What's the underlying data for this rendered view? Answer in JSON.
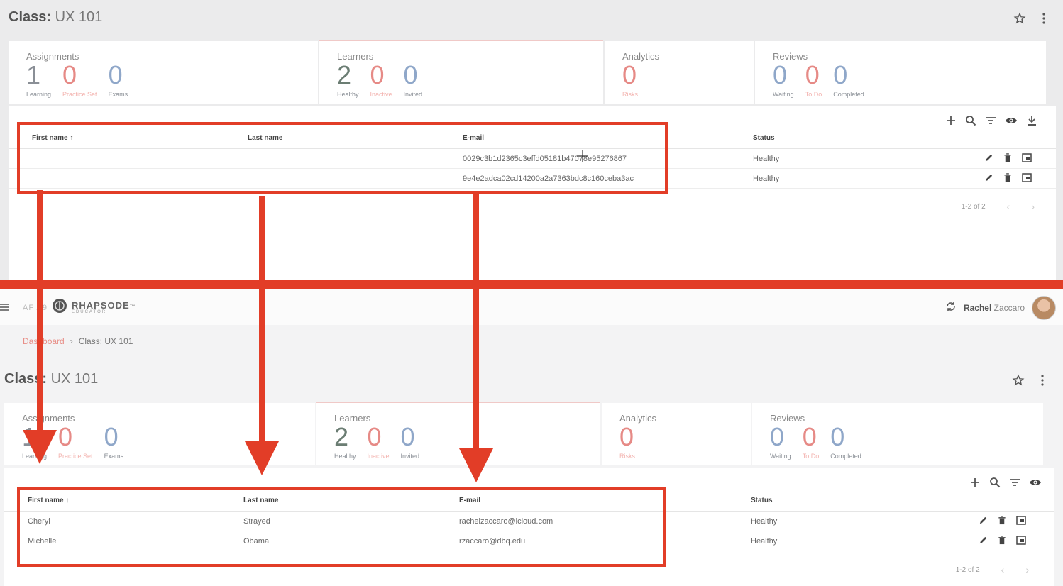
{
  "top": {
    "class_label": "Class:",
    "class_name": "UX 101",
    "cards": {
      "assignments": {
        "title": "Assignments",
        "stats": [
          {
            "value": "1",
            "label": "Learning"
          },
          {
            "value": "0",
            "label": "Practice Set"
          },
          {
            "value": "0",
            "label": "Exams"
          }
        ]
      },
      "learners": {
        "title": "Learners",
        "stats": [
          {
            "value": "2",
            "label": "Healthy"
          },
          {
            "value": "0",
            "label": "Inactive"
          },
          {
            "value": "0",
            "label": "Invited"
          }
        ]
      },
      "analytics": {
        "title": "Analytics",
        "stats": [
          {
            "value": "0",
            "label": "Risks"
          }
        ]
      },
      "reviews": {
        "title": "Reviews",
        "stats": [
          {
            "value": "0",
            "label": "Waiting"
          },
          {
            "value": "0",
            "label": "To Do"
          },
          {
            "value": "0",
            "label": "Completed"
          }
        ]
      }
    },
    "table": {
      "headers": {
        "first": "First name",
        "last": "Last name",
        "email": "E-mail",
        "status": "Status"
      },
      "rows": [
        {
          "first": "",
          "last": "",
          "email": "0029c3b1d2365c3effd05181b47078e95276867",
          "status": "Healthy"
        },
        {
          "first": "",
          "last": "",
          "email": "9e4e2adca02cd14200a2a7363bdc8c160ceba3ac",
          "status": "Healthy"
        }
      ],
      "pager": "1-2 of 2"
    }
  },
  "nav": {
    "tag": "AF A9",
    "brand": "RHAPSODE",
    "brand_tm": "™",
    "sub": "EDUCATOR",
    "user_first": "Rachel",
    "user_last": "Zaccaro",
    "breadcrumb_link": "Dashboard",
    "breadcrumb_sep": "›",
    "breadcrumb_current": "Class: UX 101"
  },
  "bottom": {
    "class_label": "Class:",
    "class_name": "UX 101",
    "cards": {
      "assignments": {
        "title": "Assignments",
        "stats": [
          {
            "value": "1",
            "label": "Learning"
          },
          {
            "value": "0",
            "label": "Practice Set"
          },
          {
            "value": "0",
            "label": "Exams"
          }
        ]
      },
      "learners": {
        "title": "Learners",
        "stats": [
          {
            "value": "2",
            "label": "Healthy"
          },
          {
            "value": "0",
            "label": "Inactive"
          },
          {
            "value": "0",
            "label": "Invited"
          }
        ]
      },
      "analytics": {
        "title": "Analytics",
        "stats": [
          {
            "value": "0",
            "label": "Risks"
          }
        ]
      },
      "reviews": {
        "title": "Reviews",
        "stats": [
          {
            "value": "0",
            "label": "Waiting"
          },
          {
            "value": "0",
            "label": "To Do"
          },
          {
            "value": "0",
            "label": "Completed"
          }
        ]
      }
    },
    "table": {
      "headers": {
        "first": "First name",
        "last": "Last name",
        "email": "E-mail",
        "status": "Status"
      },
      "rows": [
        {
          "first": "Cheryl",
          "last": "Strayed",
          "email": "rachelzaccaro@icloud.com",
          "status": "Healthy"
        },
        {
          "first": "Michelle",
          "last": "Obama",
          "email": "rzaccaro@dbq.edu",
          "status": "Healthy"
        }
      ],
      "pager": "1-2 of 2"
    }
  },
  "colors": {
    "annotation_red": "#e23d27",
    "accent_pink": "#e88f88",
    "stat_blue": "#8fa7c9",
    "stat_green": "#6b7d73"
  },
  "icons": [
    "star-icon",
    "more-vert-icon",
    "add-icon",
    "search-icon",
    "filter-icon",
    "visibility-icon",
    "download-icon",
    "edit-icon",
    "delete-icon",
    "open-icon",
    "menu-icon",
    "sync-icon"
  ]
}
